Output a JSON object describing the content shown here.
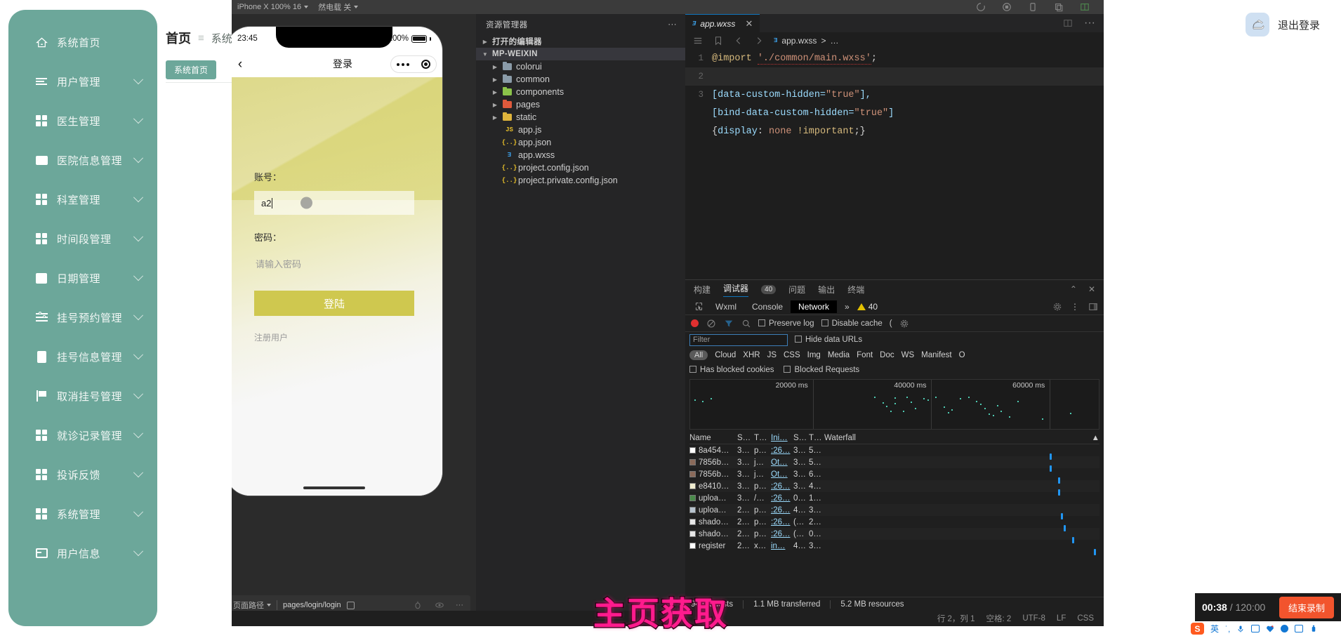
{
  "admin": {
    "sidebar": {
      "items": [
        {
          "label": "系统首页",
          "icon": "home-icon",
          "expandable": false
        },
        {
          "label": "用户管理",
          "icon": "lines-icon",
          "expandable": true
        },
        {
          "label": "医生管理",
          "icon": "grid-icon",
          "expandable": true
        },
        {
          "label": "医院信息管理",
          "icon": "screen-icon",
          "expandable": true
        },
        {
          "label": "科室管理",
          "icon": "grid-icon",
          "expandable": true
        },
        {
          "label": "时间段管理",
          "icon": "grid-icon",
          "expandable": true
        },
        {
          "label": "日期管理",
          "icon": "calendar-icon",
          "expandable": true
        },
        {
          "label": "挂号预约管理",
          "icon": "slider-icon",
          "expandable": true
        },
        {
          "label": "挂号信息管理",
          "icon": "doc-icon",
          "expandable": true
        },
        {
          "label": "取消挂号管理",
          "icon": "flag-icon",
          "expandable": true
        },
        {
          "label": "就诊记录管理",
          "icon": "grid-icon",
          "expandable": true
        },
        {
          "label": "投诉反馈",
          "icon": "grid-icon",
          "expandable": true
        },
        {
          "label": "系统管理",
          "icon": "grid-icon",
          "expandable": true
        },
        {
          "label": "用户信息",
          "icon": "card-icon",
          "expandable": true
        }
      ]
    },
    "breadcrumb": {
      "home": "首页",
      "separator": "≡",
      "current": "系统首页"
    },
    "tag": "系统首页",
    "logout": {
      "label": "退出登录",
      "avatar": "bird-avatar"
    }
  },
  "ide": {
    "toolbar": {
      "device": "iPhone X 100% 16",
      "mode": "然电载 关",
      "icons": [
        "refresh-icon",
        "compile-icon",
        "phone-icon",
        "copy-icon",
        "split-icon",
        "more-icon"
      ]
    },
    "simulator": {
      "status_time": "23:45",
      "battery_percent": "100%",
      "nav_back": "‹",
      "nav_title": "登录",
      "account_label": "账号：",
      "account_value": "a2",
      "password_label": "密码：",
      "password_placeholder": "请输入密码",
      "login_button": "登陆",
      "register_link": "注册用户"
    },
    "sim_footer": {
      "path_label": "页面路径",
      "path_value": "pages/login/login",
      "icons": [
        "bug-icon",
        "eye-icon",
        "more-icon"
      ]
    },
    "explorer": {
      "title": "资源管理器",
      "more": "···",
      "open_editors": "打开的编辑器",
      "project": "MP-WEIXIN",
      "files": [
        {
          "name": "colorui",
          "type": "folder",
          "color": "#8a9ba8",
          "indent": 1
        },
        {
          "name": "common",
          "type": "folder",
          "color": "#8a9ba8",
          "indent": 1
        },
        {
          "name": "components",
          "type": "folder",
          "color": "#8bc34a",
          "indent": 1
        },
        {
          "name": "pages",
          "type": "folder",
          "color": "#e05a3c",
          "indent": 1
        },
        {
          "name": "static",
          "type": "folder",
          "color": "#e0b53c",
          "indent": 1
        },
        {
          "name": "app.js",
          "type": "js",
          "color": "#e8c02a",
          "indent": 2,
          "glyph": "JS"
        },
        {
          "name": "app.json",
          "type": "json",
          "color": "#e8c02a",
          "indent": 2,
          "glyph": "{..}"
        },
        {
          "name": "app.wxss",
          "type": "css",
          "color": "#3ca0e8",
          "indent": 2,
          "glyph": "Ǝ"
        },
        {
          "name": "project.config.json",
          "type": "json",
          "color": "#e8c02a",
          "indent": 2,
          "glyph": "{..}"
        },
        {
          "name": "project.private.config.json",
          "type": "json",
          "color": "#e8c02a",
          "indent": 2,
          "glyph": "{..}"
        }
      ]
    },
    "editor": {
      "tab_name": "app.wxss",
      "tab_close": "✕",
      "breadcrumb_file": "app.wxss",
      "breadcrumb_more": "…",
      "lines": [
        {
          "num": "1",
          "tokens": [
            {
              "t": "@import ",
              "c": "tk-at"
            },
            {
              "t": "'./common/main.wxss'",
              "c": "tk-str"
            },
            {
              "t": ";",
              "c": "tk-pun"
            }
          ]
        },
        {
          "num": "2",
          "tokens": []
        },
        {
          "num": "3",
          "tokens": [
            {
              "t": "[data-custom-hidden=",
              "c": "tk-sel"
            },
            {
              "t": "\"true\"",
              "c": "tk-val"
            },
            {
              "t": "],",
              "c": "tk-sel"
            }
          ]
        },
        {
          "num": "",
          "tokens": [
            {
              "t": "[bind-data-custom-hidden=",
              "c": "tk-sel"
            },
            {
              "t": "\"true\"",
              "c": "tk-val"
            },
            {
              "t": "]",
              "c": "tk-sel"
            }
          ]
        },
        {
          "num": "",
          "tokens": [
            {
              "t": "{",
              "c": "tk-pun"
            },
            {
              "t": "display",
              "c": "tk-prop"
            },
            {
              "t": ": ",
              "c": "tk-pun"
            },
            {
              "t": "none",
              "c": "tk-kw"
            },
            {
              "t": " ",
              "c": "tk-pun"
            },
            {
              "t": "!important",
              "c": "tk-imp"
            },
            {
              "t": ";}",
              "c": "tk-pun"
            }
          ]
        }
      ]
    },
    "devtools": {
      "panels": [
        {
          "label": "构建",
          "active": false
        },
        {
          "label": "调试器",
          "active": true,
          "badge": "40"
        },
        {
          "label": "问题",
          "active": false
        },
        {
          "label": "输出",
          "active": false
        },
        {
          "label": "终端",
          "active": false
        }
      ],
      "panel_collapse": "⌃",
      "panel_close": "✕",
      "tabs": [
        {
          "label": "Wxml",
          "selected": false
        },
        {
          "label": "Console",
          "selected": false
        },
        {
          "label": "Network",
          "selected": true
        }
      ],
      "tabs_overflow": "»",
      "warning_count": "40",
      "controls": {
        "preserve_log": "Preserve log",
        "disable_cache": "Disable cache",
        "throttle": "(",
        "record": "record-icon",
        "clear": "clear-icon",
        "filter": "filter-icon",
        "search": "search-icon",
        "settings": "gear-icon"
      },
      "filter_placeholder": "Filter",
      "hide_data_urls": "Hide data URLs",
      "types": [
        "All",
        "Cloud",
        "XHR",
        "JS",
        "CSS",
        "Img",
        "Media",
        "Font",
        "Doc",
        "WS",
        "Manifest",
        "O"
      ],
      "blocked": [
        "Has blocked cookies",
        "Blocked Requests"
      ],
      "timeline_ticks": [
        "20000 ms",
        "40000 ms",
        "60000 ms"
      ],
      "table_headers": [
        "Name",
        "S…",
        "T…",
        "Ini…",
        "S…",
        "T…",
        "Waterfall"
      ],
      "rows": [
        {
          "name": "8a454…",
          "s": "3…",
          "t": "p…",
          "ini": ":26…",
          "s2": "3…",
          "t2": "5…",
          "wf": 82,
          "fav": "#ffffff"
        },
        {
          "name": "7856b…",
          "s": "3…",
          "t": "j…",
          "ini": "Ot…",
          "s2": "3…",
          "t2": "5…",
          "wf": 82,
          "fav": "#8a6a5a"
        },
        {
          "name": "7856b…",
          "s": "3…",
          "t": "j…",
          "ini": "Ot…",
          "s2": "3…",
          "t2": "6…",
          "wf": 85,
          "fav": "#8a6a5a"
        },
        {
          "name": "e8410…",
          "s": "3…",
          "t": "p…",
          "ini": ":26…",
          "s2": "3…",
          "t2": "4…",
          "wf": 85,
          "fav": "#efeccf"
        },
        {
          "name": "uploa…",
          "s": "3…",
          "t": "/…",
          "ini": ":26…",
          "s2": "0…",
          "t2": "1…",
          "wf": 0,
          "fav": "#4a8a4a"
        },
        {
          "name": "uploa…",
          "s": "2…",
          "t": "p…",
          "ini": ":26…",
          "s2": "4…",
          "t2": "3…",
          "wf": 86,
          "fav": "#b8c4cf"
        },
        {
          "name": "shado…",
          "s": "2…",
          "t": "p…",
          "ini": ":26…",
          "s2": "(…",
          "t2": "2…",
          "wf": 87,
          "fav": "#e8e8e8"
        },
        {
          "name": "shado…",
          "s": "2…",
          "t": "p…",
          "ini": ":26…",
          "s2": "(…",
          "t2": "0…",
          "wf": 90,
          "fav": "#e8e8e8"
        },
        {
          "name": "register",
          "s": "2…",
          "t": "x…",
          "ini": "in…",
          "s2": "4…",
          "t2": "3…",
          "wf": 98,
          "fav": "#ffffff"
        }
      ],
      "summary": {
        "requests": "94 requests",
        "transferred": "1.1 MB transferred",
        "resources": "5.2 MB resources"
      }
    },
    "status_bar": {
      "position": "行 2，列 1",
      "spaces": "空格: 2",
      "encoding": "UTF-8",
      "eol": "LF",
      "language": "CSS"
    }
  },
  "watermark": "主页获取",
  "recorder": {
    "elapsed": "00:38",
    "separator": " / ",
    "total": "120:00",
    "stop_label": "结束录制"
  },
  "ime": {
    "logo": "S",
    "lang": "英",
    "icons": [
      "mic-icon",
      "keyboard-icon",
      "emoji-icon",
      "robot-icon",
      "apps-icon",
      "tools-icon"
    ]
  }
}
